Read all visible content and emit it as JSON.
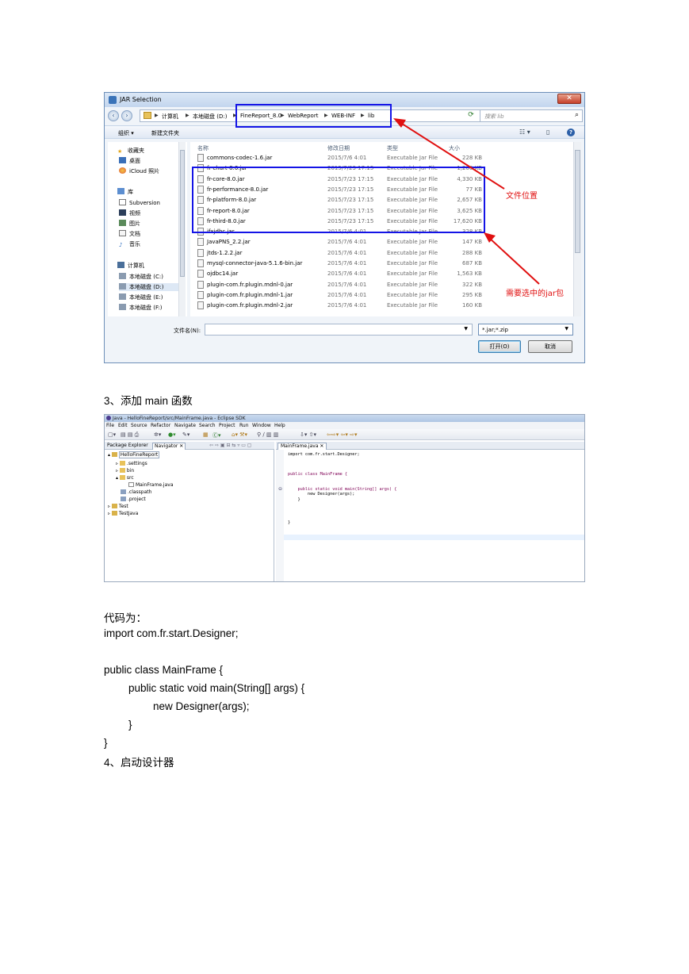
{
  "dialog": {
    "title": "JAR Selection",
    "close_glyph": "✕",
    "back_glyph": "‹",
    "forward_glyph": "›",
    "breadcrumb": [
      "计算机",
      "本地磁盘 (D:)",
      "FineReport_8.0",
      "WebReport",
      "WEB-INF",
      "lib"
    ],
    "search_placeholder": "搜索 lib",
    "toolbar": {
      "organize": "组织 ▾",
      "new_folder": "新建文件夹"
    },
    "nav": {
      "favorites": "收藏夹",
      "desktop": "桌面",
      "icloud": "iCloud 照片",
      "libraries": "库",
      "subversion": "Subversion",
      "videos": "视频",
      "pictures": "图片",
      "documents": "文档",
      "music": "音乐",
      "computer": "计算机",
      "drive_c": "本地磁盘 (C:)",
      "drive_d": "本地磁盘 (D:)",
      "drive_e": "本地磁盘 (E:)",
      "drive_f": "本地磁盘 (F:)"
    },
    "columns": {
      "name": "名称",
      "date": "修改日期",
      "type": "类型",
      "size": "大小"
    },
    "files": [
      {
        "name": "commons-codec-1.6.jar",
        "date": "2015/7/6 4:01",
        "type": "Executable Jar File",
        "size": "228 KB"
      },
      {
        "name": "fr-chart-8.0.jar",
        "date": "2015/7/23 17:15",
        "type": "Executable Jar File",
        "size": "1,200 KB"
      },
      {
        "name": "fr-core-8.0.jar",
        "date": "2015/7/23 17:15",
        "type": "Executable Jar File",
        "size": "4,330 KB"
      },
      {
        "name": "fr-performance-8.0.jar",
        "date": "2015/7/23 17:15",
        "type": "Executable Jar File",
        "size": "77 KB"
      },
      {
        "name": "fr-platform-8.0.jar",
        "date": "2015/7/23 17:15",
        "type": "Executable Jar File",
        "size": "2,657 KB"
      },
      {
        "name": "fr-report-8.0.jar",
        "date": "2015/7/23 17:15",
        "type": "Executable Jar File",
        "size": "3,625 KB"
      },
      {
        "name": "fr-third-8.0.jar",
        "date": "2015/7/23 17:15",
        "type": "Executable Jar File",
        "size": "17,620 KB"
      },
      {
        "name": "ifxjdbc.jar",
        "date": "2015/7/6 4:01",
        "type": "Executable Jar File",
        "size": "328 KB"
      },
      {
        "name": "JavaPNS_2.2.jar",
        "date": "2015/7/6 4:01",
        "type": "Executable Jar File",
        "size": "147 KB"
      },
      {
        "name": "jtds-1.2.2.jar",
        "date": "2015/7/6 4:01",
        "type": "Executable Jar File",
        "size": "288 KB"
      },
      {
        "name": "mysql-connector-java-5.1.6-bin.jar",
        "date": "2015/7/6 4:01",
        "type": "Executable Jar File",
        "size": "687 KB"
      },
      {
        "name": "ojdbc14.jar",
        "date": "2015/7/6 4:01",
        "type": "Executable Jar File",
        "size": "1,563 KB"
      },
      {
        "name": "plugin-com.fr.plugin.mdnl-0.jar",
        "date": "2015/7/6 4:01",
        "type": "Executable Jar File",
        "size": "322 KB"
      },
      {
        "name": "plugin-com.fr.plugin.mdnl-1.jar",
        "date": "2015/7/6 4:01",
        "type": "Executable Jar File",
        "size": "295 KB"
      },
      {
        "name": "plugin-com.fr.plugin.mdnl-2.jar",
        "date": "2015/7/6 4:01",
        "type": "Executable Jar File",
        "size": "160 KB"
      }
    ],
    "filename_label": "文件名(N):",
    "filename_value": "",
    "filter_value": "*.jar;*.zip",
    "open_button": "打开(O)",
    "cancel_button": "取消"
  },
  "annotations": {
    "file_location": "文件位置",
    "required_jars": "需要选中的jar包",
    "color": "#e01010",
    "box_color": "#1414e6"
  },
  "step3": "3、添加 main 函数",
  "eclipse": {
    "title": "Java - HelloFineReport/src/MainFrame.java - Eclipse SDK",
    "menu": [
      "File",
      "Edit",
      "Source",
      "Refactor",
      "Navigate",
      "Search",
      "Project",
      "Run",
      "Window",
      "Help"
    ],
    "tabs": {
      "package_explorer": "Package Explorer",
      "navigator": "Navigator ✕"
    },
    "tree": {
      "project": "HelloFineReport",
      "settings": ".settings",
      "bin": "bin",
      "src": "src",
      "mainframe": "MainFrame.java",
      "classpath": ".classpath",
      "project_file": ".project",
      "test": "Test",
      "testjava": "TestJava"
    },
    "editor_tab": "MainFrame.java ✕",
    "code_lines": [
      "import com.fr.start.Designer;",
      "",
      "public class MainFrame {",
      "",
      "    public static void main(String[] args) {",
      "        new Designer(args);",
      "    }",
      "",
      "}"
    ]
  },
  "code_intro": "代码为：",
  "code_text": [
    "import com.fr.start.Designer;",
    "",
    "public class MainFrame {",
    "public static void main(String[] args) {",
    "new Designer(args);",
    "}",
    "}"
  ],
  "step4": "4、启动设计器"
}
